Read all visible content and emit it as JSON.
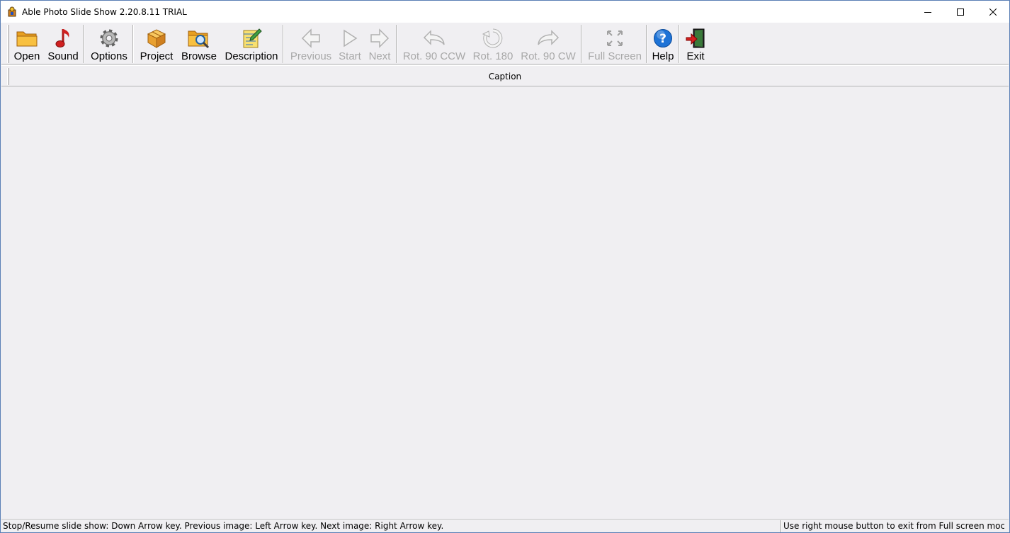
{
  "window": {
    "title": "Able Photo Slide Show 2.20.8.11 TRIAL"
  },
  "toolbar": {
    "buttons": [
      {
        "label": "Open",
        "icon": "folder-icon",
        "enabled": true
      },
      {
        "label": "Sound",
        "icon": "music-note-icon",
        "enabled": true
      },
      {
        "label": "Options",
        "icon": "gear-icon",
        "enabled": true
      },
      {
        "label": "Project",
        "icon": "box-icon",
        "enabled": true
      },
      {
        "label": "Browse",
        "icon": "folder-search-icon",
        "enabled": true
      },
      {
        "label": "Description",
        "icon": "notepad-icon",
        "enabled": true
      },
      {
        "label": "Previous",
        "icon": "arrow-left-icon",
        "enabled": false
      },
      {
        "label": "Start",
        "icon": "play-icon",
        "enabled": false
      },
      {
        "label": "Next",
        "icon": "arrow-right-icon",
        "enabled": false
      },
      {
        "label": "Rot. 90 CCW",
        "icon": "rotate-ccw-icon",
        "enabled": false
      },
      {
        "label": "Rot. 180",
        "icon": "rotate-180-icon",
        "enabled": false
      },
      {
        "label": "Rot. 90 CW",
        "icon": "rotate-cw-icon",
        "enabled": false
      },
      {
        "label": "Full Screen",
        "icon": "fullscreen-icon",
        "enabled": false
      },
      {
        "label": "Help",
        "icon": "help-icon",
        "enabled": true
      },
      {
        "label": "Exit",
        "icon": "exit-door-icon",
        "enabled": true
      }
    ]
  },
  "caption": {
    "text": "Caption"
  },
  "statusbar": {
    "left": "Stop/Resume slide show: Down Arrow key. Previous image: Left Arrow key. Next image: Right Arrow key.",
    "right": "Use right mouse button to exit from Full screen moc"
  },
  "colors": {
    "background": "#f0eff2",
    "disabled_text": "#a8a8a8",
    "help_blue": "#1e73d6",
    "exit_red": "#d42020"
  }
}
